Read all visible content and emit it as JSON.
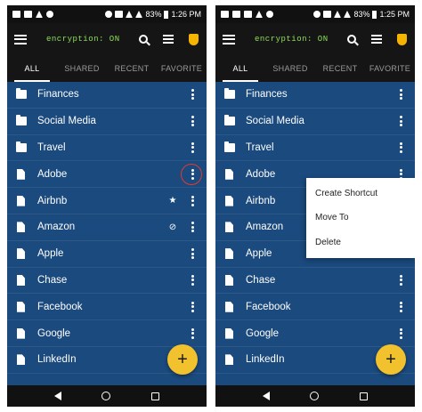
{
  "status_bar": {
    "battery": "83%",
    "time_left": "1:26 PM",
    "time_right": "1:25 PM"
  },
  "toolbar": {
    "title": "encryption: ON"
  },
  "tabs": [
    {
      "label": "ALL",
      "active": true
    },
    {
      "label": "SHARED",
      "active": false
    },
    {
      "label": "RECENT",
      "active": false
    },
    {
      "label": "FAVORITE",
      "active": false
    }
  ],
  "items": [
    {
      "label": "Finances",
      "type": "folder"
    },
    {
      "label": "Social Media",
      "type": "folder"
    },
    {
      "label": "Travel",
      "type": "folder"
    },
    {
      "label": "Adobe",
      "type": "file"
    },
    {
      "label": "Airbnb",
      "type": "file",
      "left_badge": "★"
    },
    {
      "label": "Amazon",
      "type": "file",
      "left_badge": "⊘"
    },
    {
      "label": "Apple",
      "type": "file"
    },
    {
      "label": "Chase",
      "type": "file"
    },
    {
      "label": "Facebook",
      "type": "file"
    },
    {
      "label": "Google",
      "type": "file"
    },
    {
      "label": "LinkedIn",
      "type": "file"
    }
  ],
  "context_menu": {
    "items": [
      "Create Shortcut",
      "Move To",
      "Delete"
    ]
  },
  "fab": {
    "label": "+"
  },
  "colors": {
    "accent": "#f2c12e",
    "list_bg": "#1b4a7e",
    "toolbar_bg": "#151515",
    "title_green": "#8ee05a",
    "highlight_circle": "#e23b2e"
  }
}
